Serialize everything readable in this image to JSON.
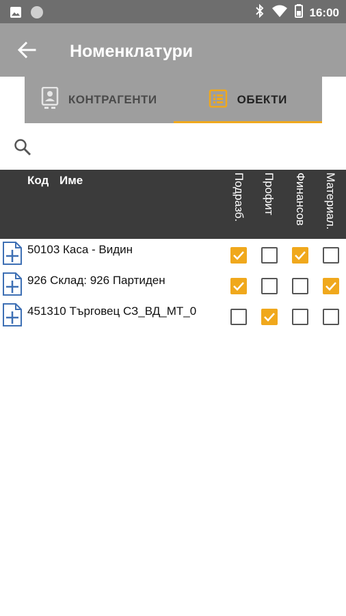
{
  "status": {
    "time": "16:00"
  },
  "appbar": {
    "title": "Номенклатури"
  },
  "tabs": [
    {
      "label": "КОНТРАГЕНТИ",
      "active": false
    },
    {
      "label": "ОБЕКТИ",
      "active": true
    }
  ],
  "search": {
    "value": "",
    "placeholder": ""
  },
  "table": {
    "headers": {
      "code": "Код",
      "name": "Име"
    },
    "flag_columns": [
      "Подразб.",
      "Профит",
      "Финансов",
      "Материал."
    ],
    "rows": [
      {
        "text": "50103 Каса - Видин",
        "flags": [
          true,
          false,
          true,
          false
        ]
      },
      {
        "text": "926 Склад: 926 Партиден",
        "flags": [
          true,
          false,
          false,
          true
        ]
      },
      {
        "text": "451310 Търговец СЗ_ВД_МТ_0",
        "flags": [
          false,
          true,
          false,
          false
        ]
      }
    ]
  },
  "colors": {
    "accent": "#f0a81c",
    "appbar": "#9e9e9e",
    "header": "#3b3b3b"
  }
}
